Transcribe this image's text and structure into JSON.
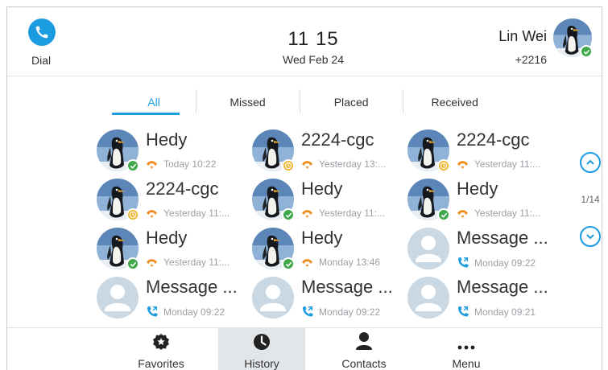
{
  "header": {
    "dial_label": "Dial",
    "time": "11 15",
    "date": "Wed Feb 24",
    "account_name": "Lin Wei",
    "account_ext": "+2216"
  },
  "tabs": [
    {
      "label": "All",
      "active": true
    },
    {
      "label": "Missed",
      "active": false
    },
    {
      "label": "Placed",
      "active": false
    },
    {
      "label": "Received",
      "active": false
    }
  ],
  "entries": [
    {
      "name": "Hedy",
      "time": "Today 10:22",
      "call_type": "missed",
      "avatar": "penguin",
      "status": "online"
    },
    {
      "name": "2224-cgc",
      "time": "Yesterday 13:...",
      "call_type": "missed",
      "avatar": "penguin",
      "status": "away"
    },
    {
      "name": "2224-cgc",
      "time": "Yesterday 11:...",
      "call_type": "missed",
      "avatar": "penguin",
      "status": "away"
    },
    {
      "name": "2224-cgc",
      "time": "Yesterday 11:...",
      "call_type": "missed",
      "avatar": "penguin",
      "status": "away"
    },
    {
      "name": "Hedy",
      "time": "Yesterday 11:...",
      "call_type": "missed",
      "avatar": "penguin",
      "status": "online"
    },
    {
      "name": "Hedy",
      "time": "Yesterday 11:...",
      "call_type": "missed",
      "avatar": "penguin",
      "status": "online"
    },
    {
      "name": "Hedy",
      "time": "Yesterday 11:...",
      "call_type": "missed",
      "avatar": "penguin",
      "status": "online"
    },
    {
      "name": "Hedy",
      "time": "Monday 13:46",
      "call_type": "missed",
      "avatar": "penguin",
      "status": "online"
    },
    {
      "name": "Message ...",
      "time": "Monday 09:22",
      "call_type": "placed",
      "avatar": "default",
      "status": "none"
    },
    {
      "name": "Message ...",
      "time": "Monday 09:22",
      "call_type": "placed",
      "avatar": "default",
      "status": "none"
    },
    {
      "name": "Message ...",
      "time": "Monday 09:22",
      "call_type": "placed",
      "avatar": "default",
      "status": "none"
    },
    {
      "name": "Message ...",
      "time": "Monday 09:21",
      "call_type": "placed",
      "avatar": "default",
      "status": "none"
    }
  ],
  "pager": {
    "count": "1/14"
  },
  "bottom_nav": [
    {
      "label": "Favorites",
      "icon": "star-badge-icon",
      "active": false
    },
    {
      "label": "History",
      "icon": "clock-icon",
      "active": true
    },
    {
      "label": "Contacts",
      "icon": "person-icon",
      "active": false
    },
    {
      "label": "Menu",
      "icon": "more-icon",
      "active": false
    }
  ],
  "colors": {
    "accent": "#1b9be0",
    "missed": "#f28a1a",
    "online": "#3fa84a",
    "away": "#f0b429",
    "muted": "#9a9fa4"
  }
}
